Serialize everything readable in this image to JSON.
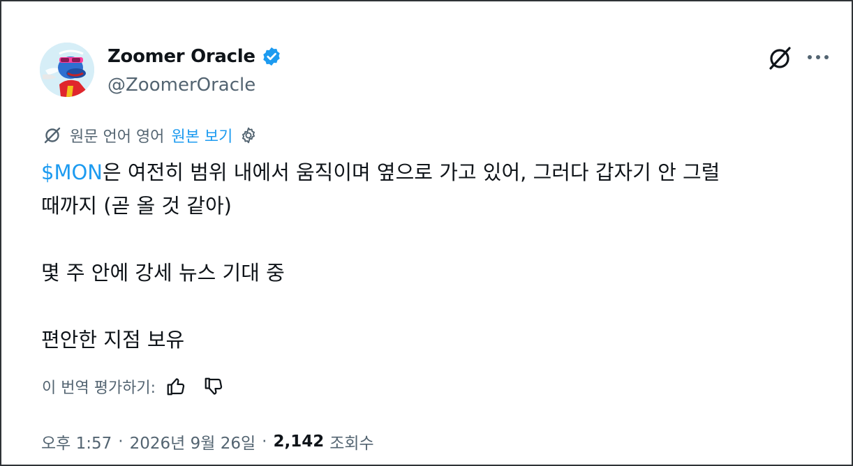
{
  "author": {
    "display_name": "Zoomer Oracle",
    "handle": "@ZoomerOracle",
    "verified": true,
    "avatar_icon": "avatar-cartoon-frog-icon"
  },
  "header_actions": {
    "grok_icon": "grok-icon",
    "more_icon": "more-dots-icon"
  },
  "translation": {
    "notice": "원문 언어 영어",
    "show_original": "원본 보기",
    "settings_icon": "gear-icon"
  },
  "tweet": {
    "cashtag": "$MON",
    "line1_rest": "은 여전히 범위 내에서 움직이며 옆으로 가고 있어, 그러다 갑자기 안 그럴",
    "line2": "때까지 (곧 올 것 같아)",
    "paragraph2": "몇 주 안에 강세 뉴스 기대 중",
    "paragraph3": "편안한 지점 보유"
  },
  "rating": {
    "label": "이 번역 평가하기:"
  },
  "meta": {
    "time": "오후 1:57",
    "separator": "·",
    "date": "2026년 9월 26일",
    "views_count": "2,142",
    "views_label": "조회수"
  },
  "colors": {
    "accent": "#1d9bf0",
    "text": "#0f1419",
    "secondary": "#536471"
  }
}
